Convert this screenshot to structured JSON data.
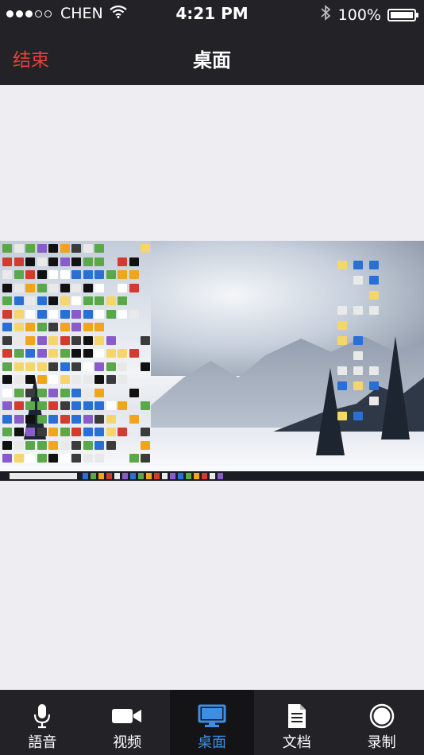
{
  "status_bar": {
    "carrier": "CHEN",
    "time": "4:21 PM",
    "battery": "100%",
    "battery_level": 1.0,
    "signal_full_dots": 3,
    "signal_total_dots": 5
  },
  "nav": {
    "end_label": "结束",
    "title": "桌面"
  },
  "tabs": [
    {
      "label": "語音",
      "icon": "microphone-icon"
    },
    {
      "label": "视频",
      "icon": "video-camera-icon"
    },
    {
      "label": "桌面",
      "icon": "monitor-icon",
      "active": true
    },
    {
      "label": "文档",
      "icon": "document-icon"
    },
    {
      "label": "录制",
      "icon": "record-icon"
    }
  ],
  "colors": {
    "bar_bg": "#232327",
    "end_red": "#e8403a",
    "active_blue": "#3c8fe6",
    "content_bg": "#eeedf2"
  }
}
